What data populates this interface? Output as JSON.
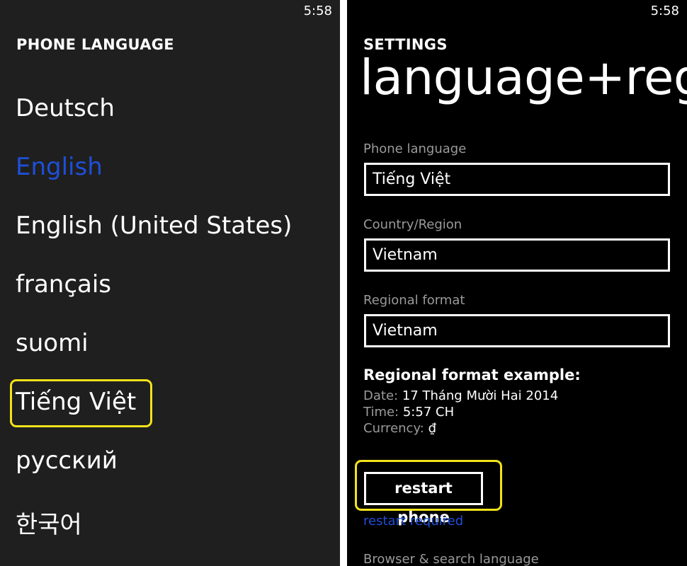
{
  "status_bar": {
    "time": "5:58"
  },
  "language_picker": {
    "title": "PHONE LANGUAGE",
    "languages": [
      {
        "label": "Deutsch"
      },
      {
        "label": "English"
      },
      {
        "label": "English (United States)"
      },
      {
        "label": "français"
      },
      {
        "label": "suomi"
      },
      {
        "label": "Tiếng Việt"
      },
      {
        "label": "русский"
      },
      {
        "label": "한국어"
      }
    ],
    "selected_label": "English",
    "highlighted_label": "Tiếng Việt"
  },
  "settings": {
    "section_label": "SETTINGS",
    "page_title": "language+region",
    "phone_language": {
      "label": "Phone language",
      "value": "Tiếng Việt"
    },
    "country_region": {
      "label": "Country/Region",
      "value": "Vietnam"
    },
    "regional_format": {
      "label": "Regional format",
      "value": "Vietnam"
    },
    "format_example": {
      "title": "Regional format example:",
      "date_key": "Date:",
      "date_value": "17 Tháng Mười Hai 2014",
      "time_key": "Time:",
      "time_value": "5:57 CH",
      "currency_key": "Currency:",
      "currency_value": "₫"
    },
    "restart_button_label": "restart phone",
    "restart_note": "restart required",
    "browser_search_label": "Browser & search language"
  },
  "colors": {
    "accent_blue": "#1f4fd8",
    "highlight_yellow": "#f3e21b",
    "left_background": "#1f1f1f",
    "right_background": "#000000",
    "secondary_text": "#9a9a9a"
  }
}
